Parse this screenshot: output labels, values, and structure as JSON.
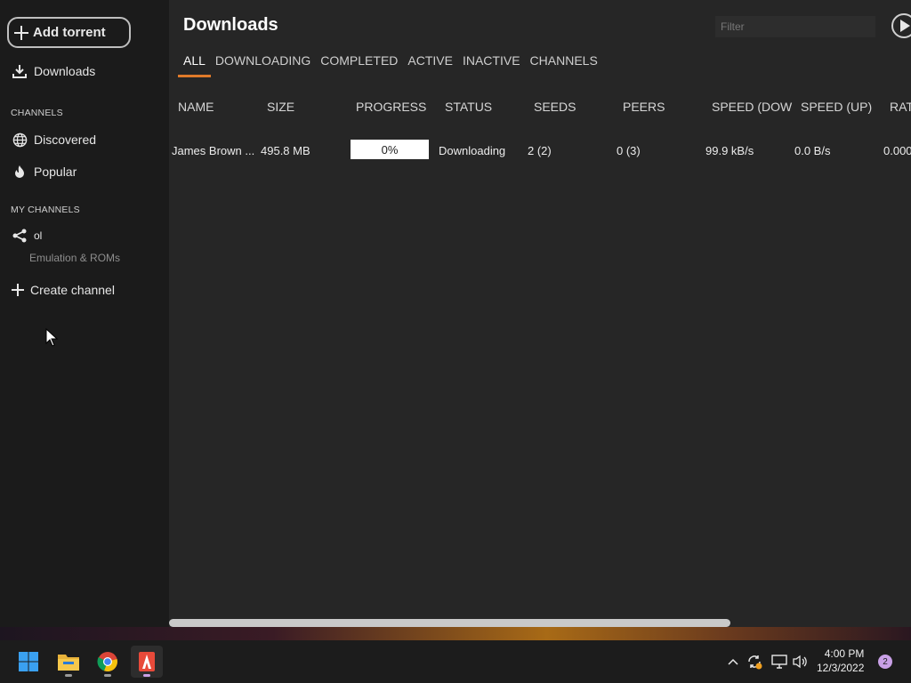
{
  "sidebar": {
    "add_torrent": "Add torrent",
    "downloads": "Downloads",
    "channels_header": "CHANNELS",
    "discovered": "Discovered",
    "popular": "Popular",
    "my_channels_header": "MY CHANNELS",
    "my_channel_name": "ol",
    "my_channel_sub": "Emulation & ROMs",
    "create_channel": "Create channel"
  },
  "main": {
    "title": "Downloads",
    "filter_placeholder": "Filter",
    "tabs": [
      "ALL",
      "DOWNLOADING",
      "COMPLETED",
      "ACTIVE",
      "INACTIVE",
      "CHANNELS"
    ],
    "active_tab": "ALL",
    "columns": [
      "NAME",
      "SIZE",
      "PROGRESS",
      "STATUS",
      "SEEDS",
      "PEERS",
      "SPEED (DOW",
      "SPEED (UP)",
      "RAT"
    ],
    "rows": [
      {
        "name": "James Brown ...",
        "size": "495.8 MB",
        "progress": "0%",
        "status": "Downloading",
        "seeds": "2 (2)",
        "peers": "0 (3)",
        "speed_down": "99.9 kB/s",
        "speed_up": "0.0 B/s",
        "ratio": "0.000"
      }
    ]
  },
  "taskbar": {
    "apps": [
      "start-icon",
      "file-explorer-icon",
      "chrome-icon",
      "tribler-icon"
    ],
    "time": "4:00 PM",
    "date": "12/3/2022",
    "notification_count": "2"
  },
  "colors": {
    "accent": "#e07a2a",
    "sidebar_bg": "#1b1b1b",
    "main_bg": "#262626"
  }
}
